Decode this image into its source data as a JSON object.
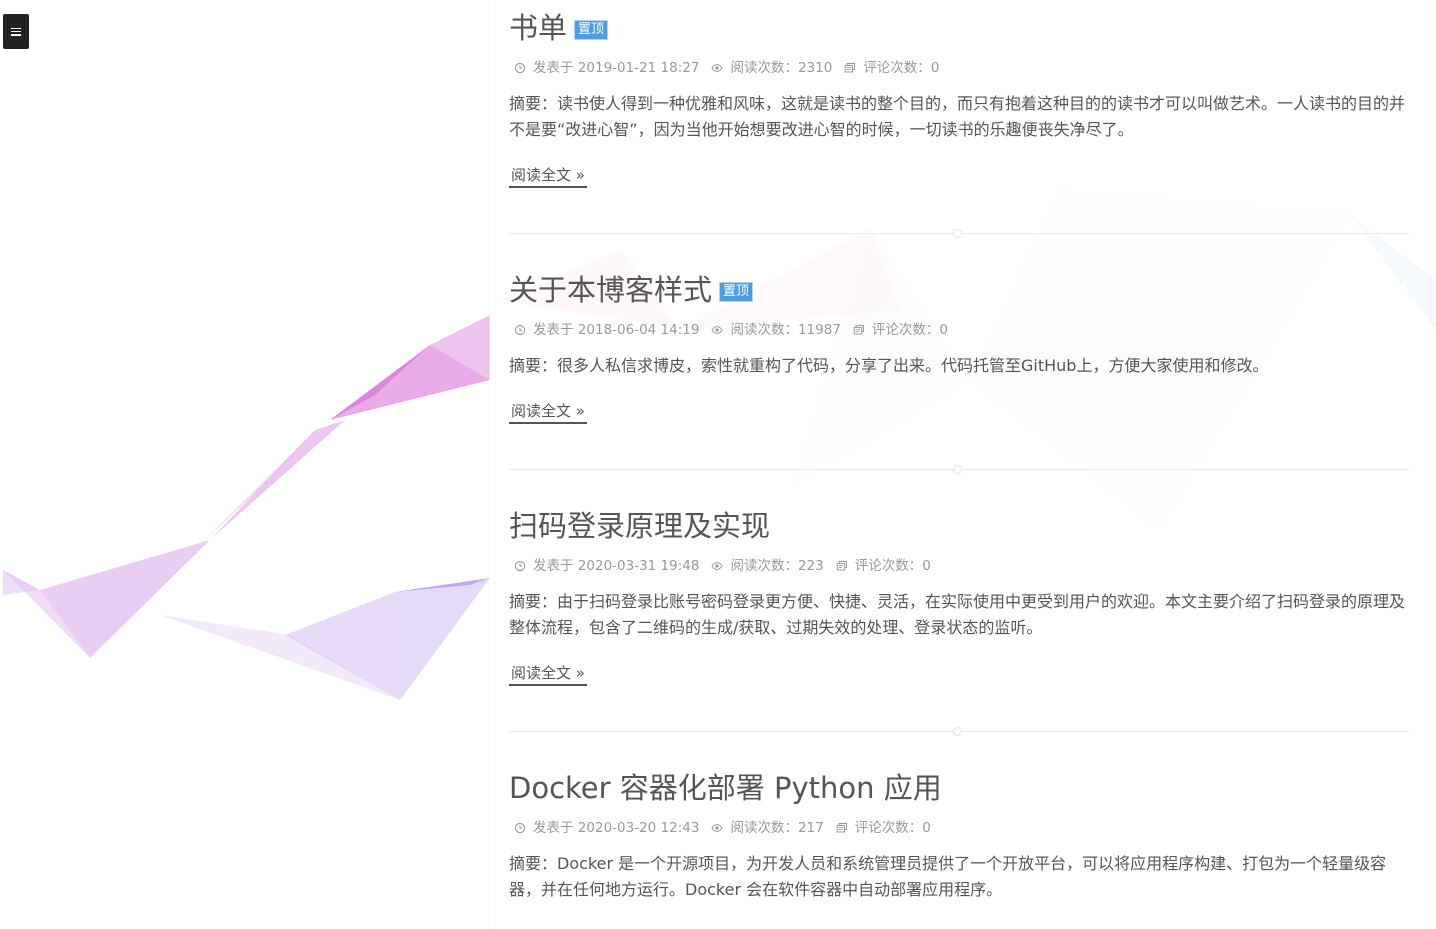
{
  "posts": [
    {
      "title": "书单",
      "pinned_label": "置顶",
      "meta": {
        "posted_label": "发表于",
        "posted_at": "2019-01-21 18:27",
        "views_label": "阅读次数：",
        "views": "2310",
        "comments_label": "评论次数：",
        "comments": "0"
      },
      "excerpt": "摘要：读书使人得到一种优雅和风味，这就是读书的整个目的，而只有抱着这种目的的读书才可以叫做艺术。一人读书的目的并不是要“改进心智”，因为当他开始想要改进心智的时候，一切读书的乐趣便丧失净尽了。",
      "read_more": "阅读全文 »"
    },
    {
      "title": "关于本博客样式",
      "pinned_label": "置顶",
      "meta": {
        "posted_label": "发表于",
        "posted_at": "2018-06-04 14:19",
        "views_label": "阅读次数：",
        "views": "11987",
        "comments_label": "评论次数：",
        "comments": "0"
      },
      "excerpt": "摘要：很多人私信求博皮，索性就重构了代码，分享了出来。代码托管至GitHub上，方便大家使用和修改。",
      "read_more": "阅读全文 »"
    },
    {
      "title": "扫码登录原理及实现",
      "pinned_label": "",
      "meta": {
        "posted_label": "发表于",
        "posted_at": "2020-03-31 19:48",
        "views_label": "阅读次数：",
        "views": "223",
        "comments_label": "评论次数：",
        "comments": "0"
      },
      "excerpt": "摘要：由于扫码登录比账号密码登录更方便、快捷、灵活，在实际使用中更受到用户的欢迎。本文主要介绍了扫码登录的原理及整体流程，包含了二维码的生成/获取、过期失效的处理、登录状态的监听。",
      "read_more": "阅读全文 »"
    },
    {
      "title": "Docker 容器化部署 Python 应用",
      "pinned_label": "",
      "meta": {
        "posted_label": "发表于",
        "posted_at": "2020-03-20 12:43",
        "views_label": "阅读次数：",
        "views": "217",
        "comments_label": "评论次数：",
        "comments": "0"
      },
      "excerpt": "摘要：Docker 是一个开源项目，为开发人员和系统管理员提供了一个开放平台，可以将应用程序构建、打包为一个轻量级容器，并在任何地方运行。Docker 会在软件容器中自动部署应用程序。",
      "read_more": ""
    }
  ],
  "icons": {
    "menu": "menu-icon",
    "posted": "clock-icon",
    "views": "eye-icon",
    "comments": "comment-icon"
  },
  "colors": {
    "pin_badge": "#4f9ce0",
    "menu_button": "#222222",
    "ribbon_pink": "#d85fd6",
    "ribbon_purple": "#b38fe6"
  }
}
